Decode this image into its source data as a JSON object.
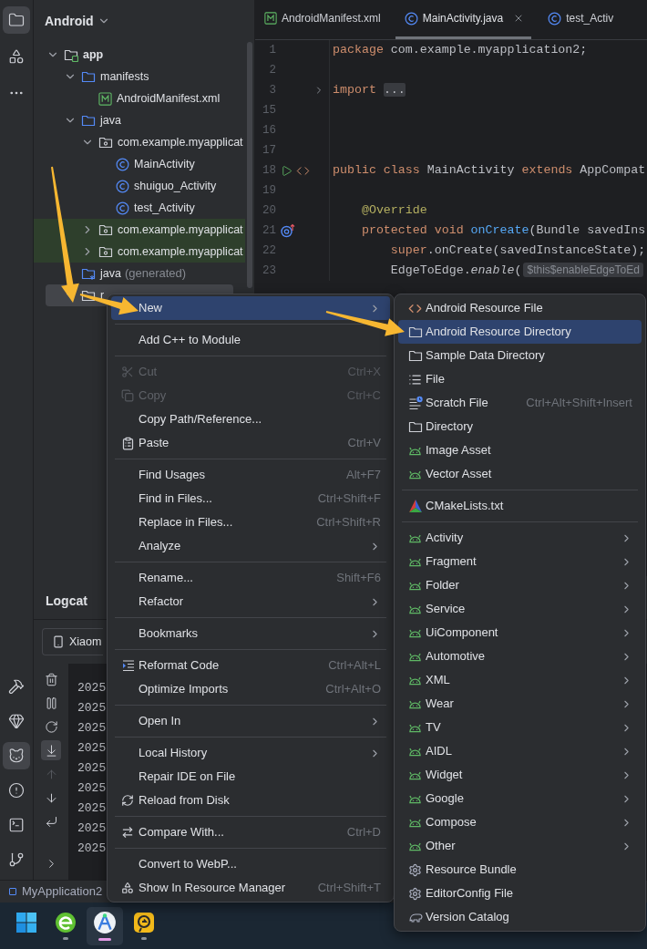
{
  "toolstrip": {
    "top": [
      {
        "kind": "project",
        "selected": true
      },
      {
        "kind": "structure",
        "selected": false
      },
      {
        "kind": "more",
        "selected": false
      }
    ],
    "bottom": [
      {
        "kind": "build",
        "selected": false
      },
      {
        "kind": "gem",
        "selected": false
      },
      {
        "kind": "logcat",
        "selected": true
      },
      {
        "kind": "problems",
        "selected": false
      },
      {
        "kind": "terminal",
        "selected": false
      },
      {
        "kind": "git",
        "selected": false
      }
    ]
  },
  "project": {
    "title": "Android",
    "tree": [
      {
        "label": "app",
        "kind": "module",
        "expanded": true,
        "selected": false,
        "highlighted": false,
        "children": [
          {
            "label": "manifests",
            "kind": "folder",
            "expanded": true,
            "selected": false,
            "highlighted": false,
            "children": [
              {
                "label": "AndroidManifest.xml",
                "kind": "manifest",
                "selected": false,
                "highlighted": false
              }
            ]
          },
          {
            "label": "java",
            "kind": "folder",
            "expanded": true,
            "selected": false,
            "highlighted": false,
            "children": [
              {
                "label": "com.example.myapplicat",
                "kind": "package",
                "expanded": true,
                "selected": false,
                "highlighted": false,
                "children": [
                  {
                    "label": "MainActivity",
                    "kind": "class",
                    "selected": false,
                    "highlighted": false
                  },
                  {
                    "label": "shuiguo_Activity",
                    "kind": "class",
                    "selected": false,
                    "highlighted": false
                  },
                  {
                    "label": "test_Activity",
                    "kind": "class",
                    "selected": false,
                    "highlighted": false
                  }
                ]
              },
              {
                "label": "com.example.myapplicat",
                "kind": "package",
                "expanded": false,
                "selected": false,
                "highlighted": true
              },
              {
                "label": "com.example.myapplicat",
                "kind": "package",
                "expanded": false,
                "selected": false,
                "highlighted": true
              }
            ]
          },
          {
            "label": "java",
            "suffix": "(generated)",
            "kind": "generated",
            "selected": false,
            "highlighted": false
          },
          {
            "label": "r",
            "kind": "resfolder",
            "expanded": true,
            "selected": true
          }
        ]
      }
    ]
  },
  "editor": {
    "tabs": [
      {
        "label": "AndroidManifest.xml",
        "kind": "manifest",
        "selected": false
      },
      {
        "label": "MainActivity.java",
        "kind": "class",
        "selected": true
      },
      {
        "label": "test_Activ",
        "kind": "class",
        "selected": false
      }
    ],
    "lines": [
      {
        "number": "1",
        "kind": "plain",
        "tokens": [
          {
            "kind": "keyword",
            "text": "package"
          },
          {
            "kind": "plain",
            "text": " com.example.myapplication2;"
          }
        ]
      },
      {
        "number": "2",
        "kind": "plain"
      },
      {
        "number": "3",
        "kind": "fold",
        "tokens": [
          {
            "kind": "keyword",
            "text": "import"
          },
          {
            "kind": "folded",
            "text": "..."
          }
        ]
      },
      {
        "number": "15",
        "kind": "plain"
      },
      {
        "number": "16",
        "kind": "plain"
      },
      {
        "number": "17",
        "kind": "plain"
      },
      {
        "number": "18",
        "kind": "run",
        "tokens": [
          {
            "kind": "keyword",
            "text": "public class"
          },
          {
            "kind": "plain",
            "text": " MainActivity "
          },
          {
            "kind": "keyword",
            "text": "extends"
          },
          {
            "kind": "plain",
            "text": " AppCompat"
          }
        ]
      },
      {
        "number": "19",
        "kind": "plain"
      },
      {
        "number": "20",
        "kind": "plain",
        "tokens": [
          {
            "kind": "annotation",
            "text": "    @Override"
          }
        ]
      },
      {
        "number": "21",
        "kind": "override",
        "tokens": [
          {
            "kind": "keyword",
            "text": "    protected void"
          },
          {
            "kind": "method",
            "text": " onCreate"
          },
          {
            "kind": "plain",
            "text": "(Bundle savedIns"
          }
        ]
      },
      {
        "number": "22",
        "kind": "plain",
        "tokens": [
          {
            "kind": "keyword",
            "text": "        super"
          },
          {
            "kind": "plain",
            "text": ".onCreate(savedInstanceState);"
          }
        ]
      },
      {
        "number": "23",
        "kind": "plain",
        "tokens": [
          {
            "kind": "plain",
            "text": "        EdgeToEdge."
          },
          {
            "kind": "italic",
            "text": "enable"
          },
          {
            "kind": "plain",
            "text": "("
          },
          {
            "kind": "hint",
            "text": "$this$enableEdgeToEd"
          }
        ]
      }
    ]
  },
  "logcat": {
    "title": "Logcat",
    "device": "Xiaom",
    "tools": [
      {
        "kind": "clear",
        "selected": false,
        "disabled": false
      },
      {
        "kind": "pause",
        "selected": false,
        "disabled": false
      },
      {
        "kind": "restart",
        "selected": false,
        "disabled": false
      },
      {
        "kind": "scroll-end",
        "selected": true,
        "disabled": false
      },
      {
        "kind": "up",
        "selected": false,
        "disabled": true
      },
      {
        "kind": "down",
        "selected": false,
        "disabled": false
      },
      {
        "kind": "wrap",
        "selected": false,
        "disabled": false
      },
      {
        "kind": "expand",
        "selected": false,
        "disabled": false
      }
    ],
    "rows": [
      "2025",
      "2025",
      "2025",
      "2025",
      "2025",
      "2025",
      "2025",
      "2025",
      "2025"
    ]
  },
  "status_bar": {
    "project": "MyApplication2"
  },
  "taskbar": {
    "apps": [
      {
        "kind": "start",
        "selected": false,
        "running": false
      },
      {
        "kind": "browser",
        "selected": false,
        "running": true
      },
      {
        "kind": "studio",
        "selected": true,
        "running": true
      },
      {
        "kind": "remote",
        "selected": false,
        "running": true
      }
    ]
  },
  "context_menu": {
    "groups": [
      {
        "items": [
          {
            "label": "New",
            "kind": "none",
            "submenu": true,
            "selected": true,
            "disabled": false
          }
        ]
      },
      {
        "items": [
          {
            "label": "Add C++ to Module",
            "kind": "none",
            "submenu": false,
            "selected": false,
            "disabled": false
          }
        ]
      },
      {
        "items": [
          {
            "label": "Cut",
            "shortcut": "Ctrl+X",
            "kind": "cut",
            "submenu": false,
            "selected": false,
            "disabled": true
          },
          {
            "label": "Copy",
            "shortcut": "Ctrl+C",
            "kind": "copy",
            "submenu": false,
            "selected": false,
            "disabled": true
          },
          {
            "label": "Copy Path/Reference...",
            "kind": "none",
            "submenu": false,
            "selected": false,
            "disabled": false
          },
          {
            "label": "Paste",
            "shortcut": "Ctrl+V",
            "kind": "paste",
            "submenu": false,
            "selected": false,
            "disabled": false
          }
        ]
      },
      {
        "items": [
          {
            "label": "Find Usages",
            "shortcut": "Alt+F7",
            "kind": "none",
            "submenu": false,
            "selected": false,
            "disabled": false
          },
          {
            "label": "Find in Files...",
            "shortcut": "Ctrl+Shift+F",
            "kind": "none",
            "submenu": false,
            "selected": false,
            "disabled": false
          },
          {
            "label": "Replace in Files...",
            "shortcut": "Ctrl+Shift+R",
            "kind": "none",
            "submenu": false,
            "selected": false,
            "disabled": false
          },
          {
            "label": "Analyze",
            "kind": "none",
            "submenu": true,
            "selected": false,
            "disabled": false
          }
        ]
      },
      {
        "items": [
          {
            "label": "Rename...",
            "shortcut": "Shift+F6",
            "kind": "none",
            "submenu": false,
            "selected": false,
            "disabled": false
          },
          {
            "label": "Refactor",
            "kind": "none",
            "submenu": true,
            "selected": false,
            "disabled": false
          }
        ]
      },
      {
        "items": [
          {
            "label": "Bookmarks",
            "kind": "none",
            "submenu": true,
            "selected": false,
            "disabled": false
          }
        ]
      },
      {
        "items": [
          {
            "label": "Reformat Code",
            "shortcut": "Ctrl+Alt+L",
            "kind": "reformat",
            "submenu": false,
            "selected": false,
            "disabled": false
          },
          {
            "label": "Optimize Imports",
            "shortcut": "Ctrl+Alt+O",
            "kind": "none",
            "submenu": false,
            "selected": false,
            "disabled": false
          }
        ]
      },
      {
        "items": [
          {
            "label": "Open In",
            "kind": "none",
            "submenu": true,
            "selected": false,
            "disabled": false
          }
        ]
      },
      {
        "items": [
          {
            "label": "Local History",
            "kind": "none",
            "submenu": true,
            "selected": false,
            "disabled": false
          },
          {
            "label": "Repair IDE on File",
            "kind": "none",
            "submenu": false,
            "selected": false,
            "disabled": false
          },
          {
            "label": "Reload from Disk",
            "kind": "reload",
            "submenu": false,
            "selected": false,
            "disabled": false
          }
        ]
      },
      {
        "items": [
          {
            "label": "Compare With...",
            "shortcut": "Ctrl+D",
            "kind": "compare",
            "submenu": false,
            "selected": false,
            "disabled": false
          }
        ]
      },
      {
        "items": [
          {
            "label": "Convert to WebP...",
            "kind": "none",
            "submenu": false,
            "selected": false,
            "disabled": false
          },
          {
            "label": "Show In Resource Manager",
            "shortcut": "Ctrl+Shift+T",
            "kind": "resources",
            "submenu": false,
            "selected": false,
            "disabled": false
          }
        ]
      }
    ]
  },
  "submenu": {
    "groups": [
      {
        "items": [
          {
            "label": "Android Resource File",
            "kind": "xml",
            "submenu": false,
            "selected": false
          },
          {
            "label": "Android Resource Directory",
            "kind": "folder",
            "submenu": false,
            "selected": true
          },
          {
            "label": "Sample Data Directory",
            "kind": "folder",
            "submenu": false,
            "selected": false
          },
          {
            "label": "File",
            "kind": "file",
            "submenu": false,
            "selected": false
          },
          {
            "label": "Scratch File",
            "shortcut": "Ctrl+Alt+Shift+Insert",
            "kind": "scratch",
            "submenu": false,
            "selected": false
          },
          {
            "label": "Directory",
            "kind": "folder",
            "submenu": false,
            "selected": false
          },
          {
            "label": "Image Asset",
            "kind": "android",
            "submenu": false,
            "selected": false
          },
          {
            "label": "Vector Asset",
            "kind": "android",
            "submenu": false,
            "selected": false
          }
        ]
      },
      {
        "items": [
          {
            "label": "CMakeLists.txt",
            "kind": "cmake",
            "submenu": false,
            "selected": false
          }
        ]
      },
      {
        "items": [
          {
            "label": "Activity",
            "kind": "android",
            "submenu": true,
            "selected": false
          },
          {
            "label": "Fragment",
            "kind": "android",
            "submenu": true,
            "selected": false
          },
          {
            "label": "Folder",
            "kind": "android",
            "submenu": true,
            "selected": false
          },
          {
            "label": "Service",
            "kind": "android",
            "submenu": true,
            "selected": false
          },
          {
            "label": "UiComponent",
            "kind": "android",
            "submenu": true,
            "selected": false
          },
          {
            "label": "Automotive",
            "kind": "android",
            "submenu": true,
            "selected": false
          },
          {
            "label": "XML",
            "kind": "android",
            "submenu": true,
            "selected": false
          },
          {
            "label": "Wear",
            "kind": "android",
            "submenu": true,
            "selected": false
          },
          {
            "label": "TV",
            "kind": "android",
            "submenu": true,
            "selected": false
          },
          {
            "label": "AIDL",
            "kind": "android",
            "submenu": true,
            "selected": false
          },
          {
            "label": "Widget",
            "kind": "android",
            "submenu": true,
            "selected": false
          },
          {
            "label": "Google",
            "kind": "android",
            "submenu": true,
            "selected": false
          },
          {
            "label": "Compose",
            "kind": "android",
            "submenu": true,
            "selected": false
          },
          {
            "label": "Other",
            "kind": "android",
            "submenu": true,
            "selected": false
          },
          {
            "label": "Resource Bundle",
            "kind": "gear",
            "submenu": false,
            "selected": false
          },
          {
            "label": "EditorConfig File",
            "kind": "gear",
            "submenu": false,
            "selected": false
          },
          {
            "label": "Version Catalog",
            "kind": "catalog",
            "submenu": false,
            "selected": false
          }
        ]
      }
    ]
  },
  "annotation_arrows": [
    {
      "kind": "arrow"
    },
    {
      "kind": "arrow"
    },
    {
      "kind": "arrow"
    }
  ]
}
